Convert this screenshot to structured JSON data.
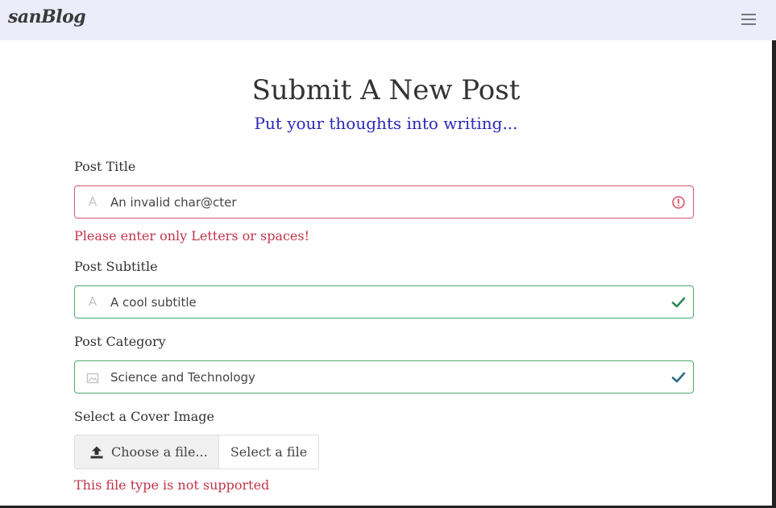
{
  "navbar": {
    "brand": "sanBlog",
    "menu_icon": "hamburger-menu-icon"
  },
  "header": {
    "title": "Submit A New Post",
    "subtitle": "Put your thoughts into writing..."
  },
  "form": {
    "post_title": {
      "label": "Post Title",
      "value": "An invalid char@cter",
      "status": "invalid",
      "error": "Please enter only Letters or spaces!",
      "icon": "font-letter-icon",
      "status_icon": "exclamation-circle-icon"
    },
    "post_subtitle": {
      "label": "Post Subtitle",
      "value": "A cool subtitle",
      "status": "valid",
      "icon": "font-letter-icon",
      "status_icon": "checkmark-icon"
    },
    "post_category": {
      "label": "Post Category",
      "value": "Science and Technology",
      "status": "valid",
      "icon": "image-icon",
      "status_icon": "checkmark-icon"
    },
    "cover_image": {
      "label": "Select a Cover Image",
      "button_label": "Choose a file...",
      "file_placeholder": "Select a file",
      "error": "This file type is not supported",
      "icon": "upload-icon"
    }
  },
  "colors": {
    "navbar_bg": "#ececfb",
    "subtitle": "#2a2ab8",
    "invalid": "#d9596a",
    "valid": "#4fa868",
    "error_text": "#c0354a"
  }
}
